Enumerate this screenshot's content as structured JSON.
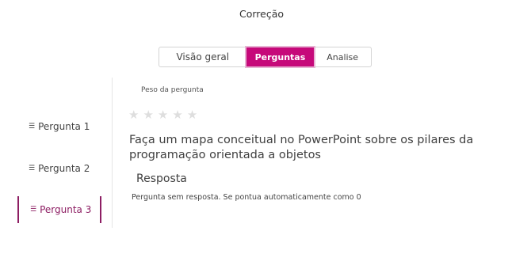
{
  "page": {
    "title": "Correção"
  },
  "tabs": [
    {
      "label": "Visão geral",
      "active": false
    },
    {
      "label": "Perguntas",
      "active": true
    },
    {
      "label": "Analise",
      "active": false
    }
  ],
  "colors": {
    "accent": "#c6097a",
    "active_item": "#8d1e63"
  },
  "sidebar": {
    "items": [
      {
        "label": "Pergunta 1",
        "icon": "layers-icon",
        "active": false
      },
      {
        "label": "Pergunta  2",
        "icon": "layers-icon",
        "active": false
      },
      {
        "label": "Pergunta  3",
        "icon": "layers-icon",
        "active": true
      }
    ]
  },
  "question": {
    "weight_label": "Peso da pergunta",
    "rating": {
      "value": 0,
      "max": 5
    },
    "text": "Faça um mapa conceitual no PowerPoint sobre os pilares da programação orientada a objetos"
  },
  "answer": {
    "title": "Resposta",
    "text": "Pergunta sem resposta. Se pontua automaticamente como 0"
  }
}
